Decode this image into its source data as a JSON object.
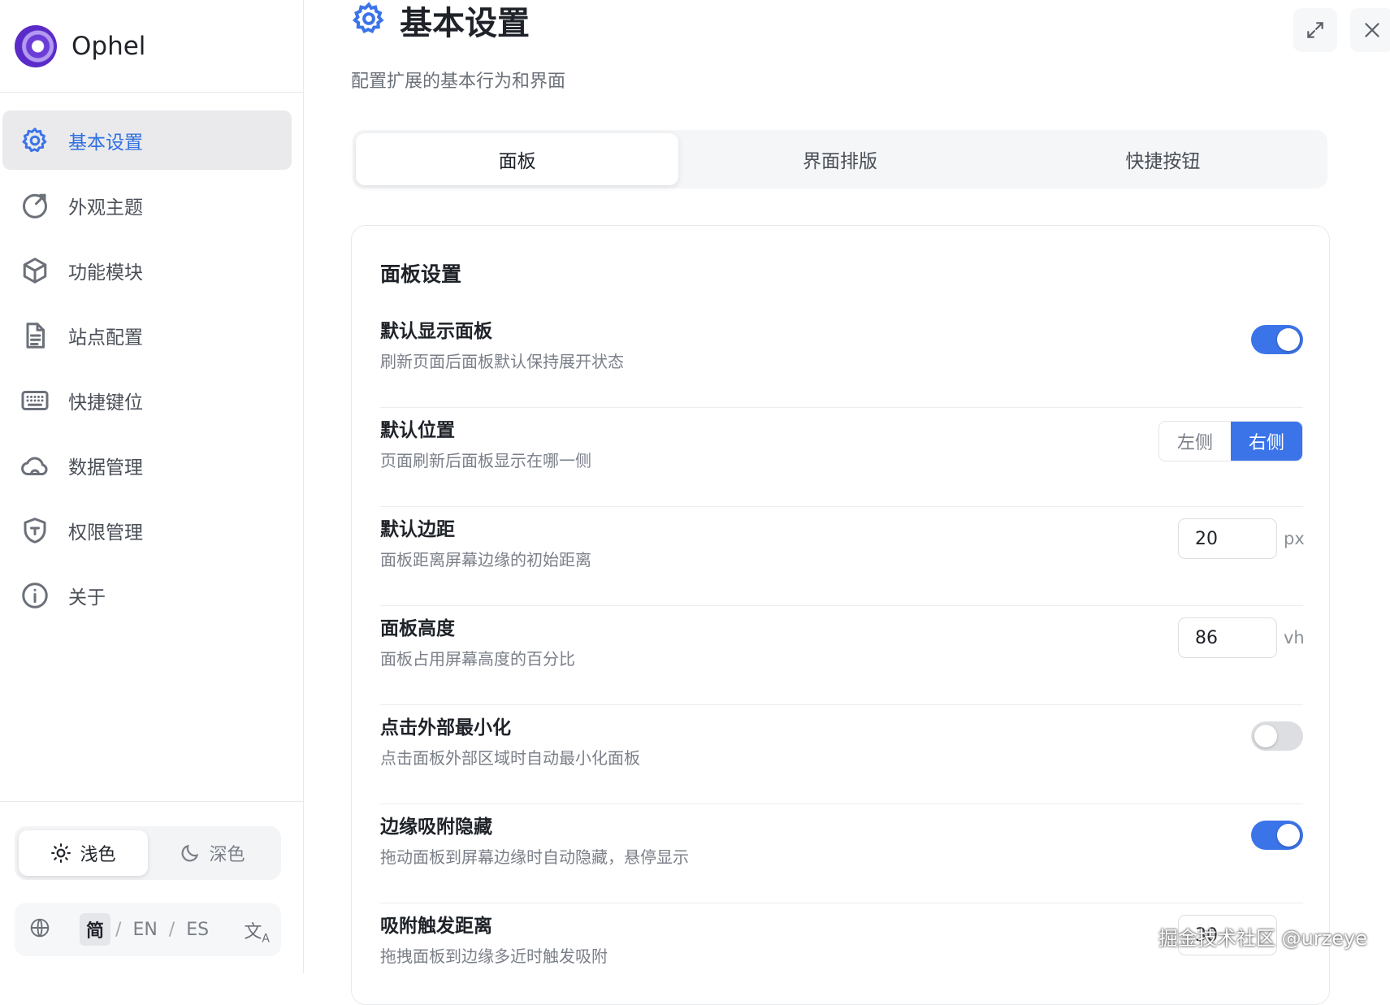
{
  "app": {
    "name": "Ophel"
  },
  "sidebar": {
    "items": [
      {
        "label": "基本设置",
        "icon": "gear-icon",
        "active": true
      },
      {
        "label": "外观主题",
        "icon": "palette-icon",
        "active": false
      },
      {
        "label": "功能模块",
        "icon": "cube-icon",
        "active": false
      },
      {
        "label": "站点配置",
        "icon": "document-icon",
        "active": false
      },
      {
        "label": "快捷键位",
        "icon": "keyboard-icon",
        "active": false
      },
      {
        "label": "数据管理",
        "icon": "cloud-icon",
        "active": false
      },
      {
        "label": "权限管理",
        "icon": "shield-icon",
        "active": false
      },
      {
        "label": "关于",
        "icon": "info-icon",
        "active": false
      }
    ],
    "theme": {
      "light": "浅色",
      "dark": "深色",
      "selected": "light"
    },
    "language": {
      "options": [
        "简",
        "EN",
        "ES"
      ],
      "separator": "/",
      "selected": "简"
    }
  },
  "header": {
    "title": "基本设置",
    "subtitle": "配置扩展的基本行为和界面"
  },
  "tabs": [
    {
      "label": "面板",
      "active": true
    },
    {
      "label": "界面排版",
      "active": false
    },
    {
      "label": "快捷按钮",
      "active": false
    }
  ],
  "panel": {
    "title": "面板设置",
    "rows": [
      {
        "title": "默认显示面板",
        "desc": "刷新页面后面板默认保持展开状态",
        "control": "toggle",
        "value": true
      },
      {
        "title": "默认位置",
        "desc": "页面刷新后面板显示在哪一侧",
        "control": "segmented",
        "options": [
          "左侧",
          "右侧"
        ],
        "value": "右侧"
      },
      {
        "title": "默认边距",
        "desc": "面板距离屏幕边缘的初始距离",
        "control": "number",
        "value": "20",
        "unit": "px"
      },
      {
        "title": "面板高度",
        "desc": "面板占用屏幕高度的百分比",
        "control": "number",
        "value": "86",
        "unit": "vh"
      },
      {
        "title": "点击外部最小化",
        "desc": "点击面板外部区域时自动最小化面板",
        "control": "toggle",
        "value": false
      },
      {
        "title": "边缘吸附隐藏",
        "desc": "拖动面板到屏幕边缘时自动隐藏，悬停显示",
        "control": "toggle",
        "value": true
      },
      {
        "title": "吸附触发距离",
        "desc": "拖拽面板到边缘多近时触发吸附",
        "control": "number",
        "value": "30",
        "unit": ""
      }
    ]
  },
  "watermark": "掘金技术社区 @urzeye",
  "colors": {
    "accent": "#3b74e8",
    "active_nav_bg": "#eaeaed"
  }
}
